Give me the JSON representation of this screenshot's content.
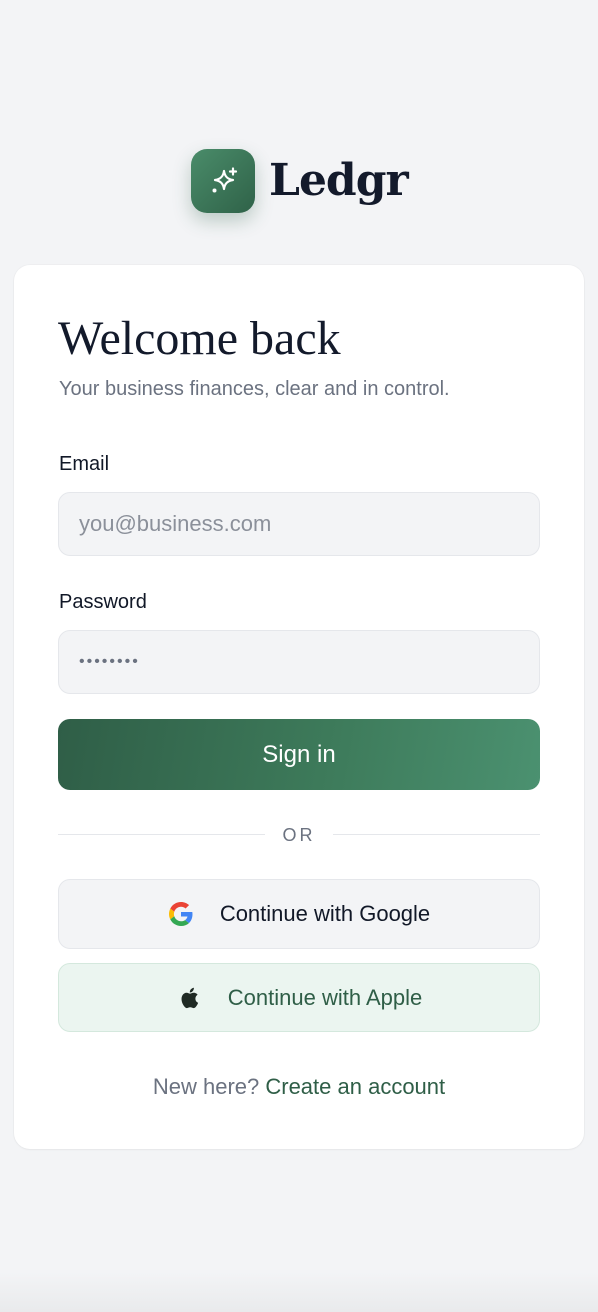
{
  "brand": {
    "name": "Ledgr",
    "logo_icon": "sparkle-icon",
    "accent_color": "#3d7a5a"
  },
  "login": {
    "title": "Welcome back",
    "subtitle": "Your business finances, clear and in control.",
    "email": {
      "label": "Email",
      "placeholder": "you@business.com",
      "value": ""
    },
    "password": {
      "label": "Password",
      "value": "••••••••"
    },
    "signin_label": "Sign in",
    "divider_text": "OR",
    "google": {
      "label": "Continue with Google",
      "icon": "google-icon"
    },
    "apple": {
      "label": "Continue with Apple",
      "icon": "apple-icon"
    },
    "footer": {
      "prompt": "New here?",
      "link_label": "Create an account"
    }
  }
}
